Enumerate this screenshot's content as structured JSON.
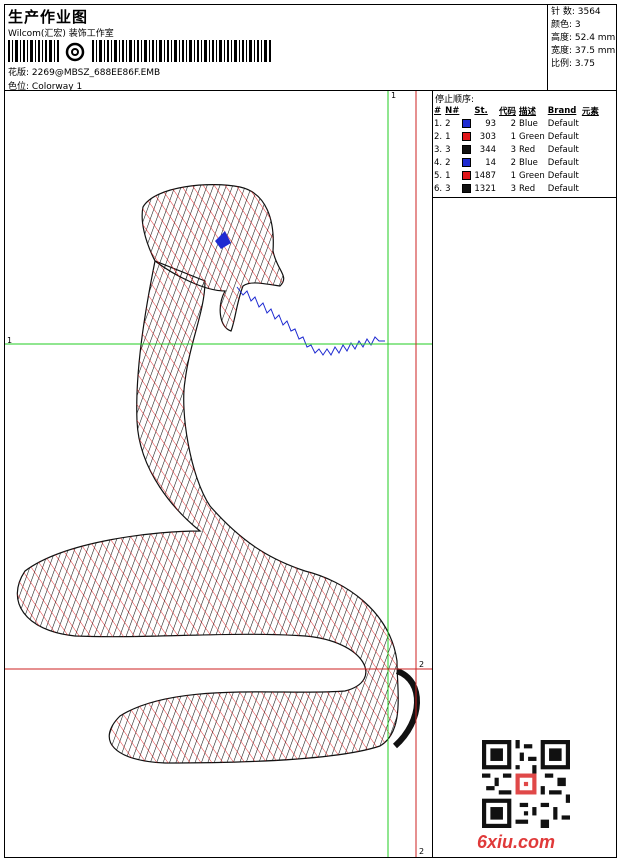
{
  "header": {
    "title": "生产作业图",
    "company": "Wilcom(汇宏) 装饰工作室",
    "design_label": "花版:",
    "design_file": "2269@MBSZ_688EE86F.EMB",
    "color_label": "色位:",
    "colorway": "Colorway 1"
  },
  "stats": {
    "stitches": "针 数: 3564",
    "colors": "颜色: 3",
    "height": "高度: 52.4 mm",
    "width": "宽度: 37.5 mm",
    "scale": "比例: 3.75"
  },
  "stop_sequence": {
    "title": "停止顺序:",
    "columns": [
      "#",
      "N#",
      "St.",
      "代码",
      "描述",
      "Brand",
      "元素"
    ],
    "rows": [
      {
        "idx": "1.",
        "n": "2",
        "st": "93",
        "code": "2",
        "desc": "Blue",
        "brand": "Default",
        "color": "#1f2bd1"
      },
      {
        "idx": "2.",
        "n": "1",
        "st": "303",
        "code": "1",
        "desc": "Green",
        "brand": "Default",
        "color": "#e0161a"
      },
      {
        "idx": "3.",
        "n": "3",
        "st": "344",
        "code": "3",
        "desc": "Red",
        "brand": "Default",
        "color": "#111111"
      },
      {
        "idx": "4.",
        "n": "2",
        "st": "14",
        "code": "2",
        "desc": "Blue",
        "brand": "Default",
        "color": "#1f2bd1"
      },
      {
        "idx": "5.",
        "n": "1",
        "st": "1487",
        "code": "1",
        "desc": "Green",
        "brand": "Default",
        "color": "#e0161a"
      },
      {
        "idx": "6.",
        "n": "3",
        "st": "1321",
        "code": "3",
        "desc": "Red",
        "brand": "Default",
        "color": "#111111"
      }
    ]
  },
  "guides": {
    "green_label_1": "1",
    "green_label_top": "1",
    "red_label_2": "2",
    "red_label_bottom": "2"
  },
  "watermark": "6xiu.com",
  "colors": {
    "guide_green": "#22cc22",
    "guide_red": "#cc2222",
    "thread_blue": "#1f2bd1",
    "thread_red": "#e0161a",
    "thread_black": "#111111"
  }
}
